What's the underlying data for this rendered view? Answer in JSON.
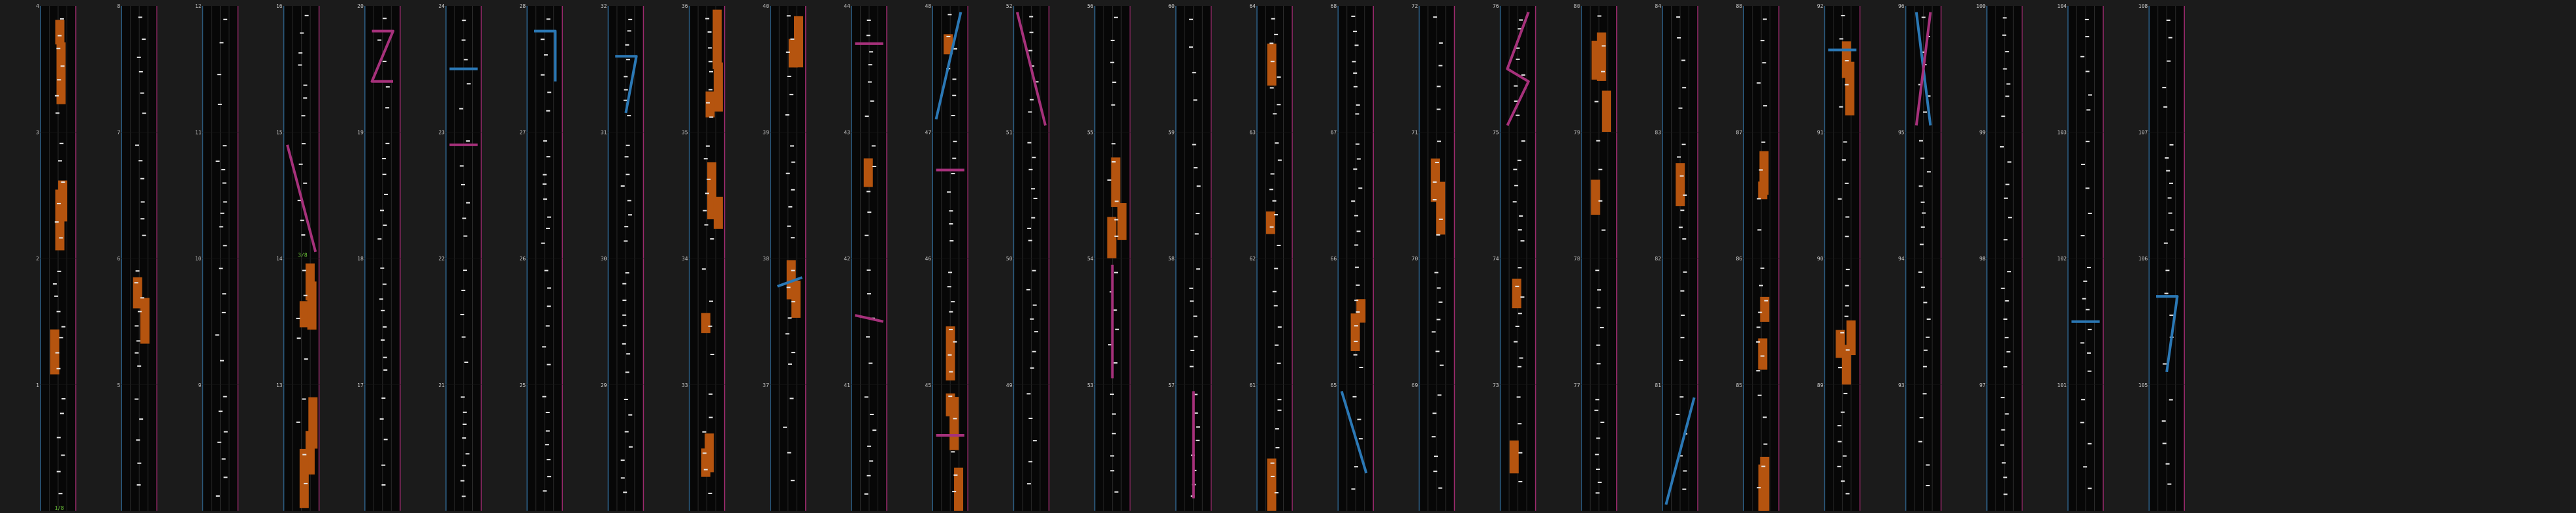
{
  "tile_labels": [
    "1",
    "2",
    "3",
    "4",
    "5",
    "6",
    "7",
    "8",
    "9",
    "10",
    "11",
    "12",
    "13",
    "14",
    "15",
    "16",
    "17",
    "18",
    "19",
    "20",
    "21",
    "22",
    "23",
    "24",
    "25",
    "26",
    "27",
    "28",
    "29",
    "30",
    "31",
    "32",
    "33",
    "34",
    "35",
    "36",
    "37",
    "38",
    "39",
    "40",
    "41",
    "42",
    "43",
    "44",
    "45",
    "46",
    "47",
    "48",
    "49",
    "50",
    "51",
    "52",
    "53",
    "54",
    "55",
    "56",
    "57",
    "58",
    "59",
    "60",
    "61",
    "62",
    "63",
    "64",
    "65",
    "66",
    "67",
    "68",
    "69",
    "70",
    "71",
    "72",
    "73",
    "74",
    "75",
    "76",
    "77",
    "78",
    "79",
    "80",
    "81",
    "82",
    "83",
    "84",
    "85",
    "86",
    "87",
    "88",
    "89",
    "90",
    "91",
    "92",
    "93",
    "94",
    "95",
    "96",
    "97",
    "98",
    "99",
    "100",
    "101",
    "102",
    "103",
    "104",
    "105",
    "106",
    "107",
    "108"
  ],
  "annotations": [
    {
      "tile": "1",
      "text": "1/8"
    },
    {
      "tile": "15",
      "text": "3/8"
    }
  ],
  "colors": {
    "background": "#1b1b1b",
    "panel": "#070707",
    "grid_line": "#2a2a2a",
    "left_border": "#2d5f86",
    "right_border": "#9a2a6c",
    "orange_block": "#b5540f",
    "tick_mark": "#e8e8e8",
    "blue_path": "#2b78b5",
    "magenta_path": "#a6317b"
  }
}
